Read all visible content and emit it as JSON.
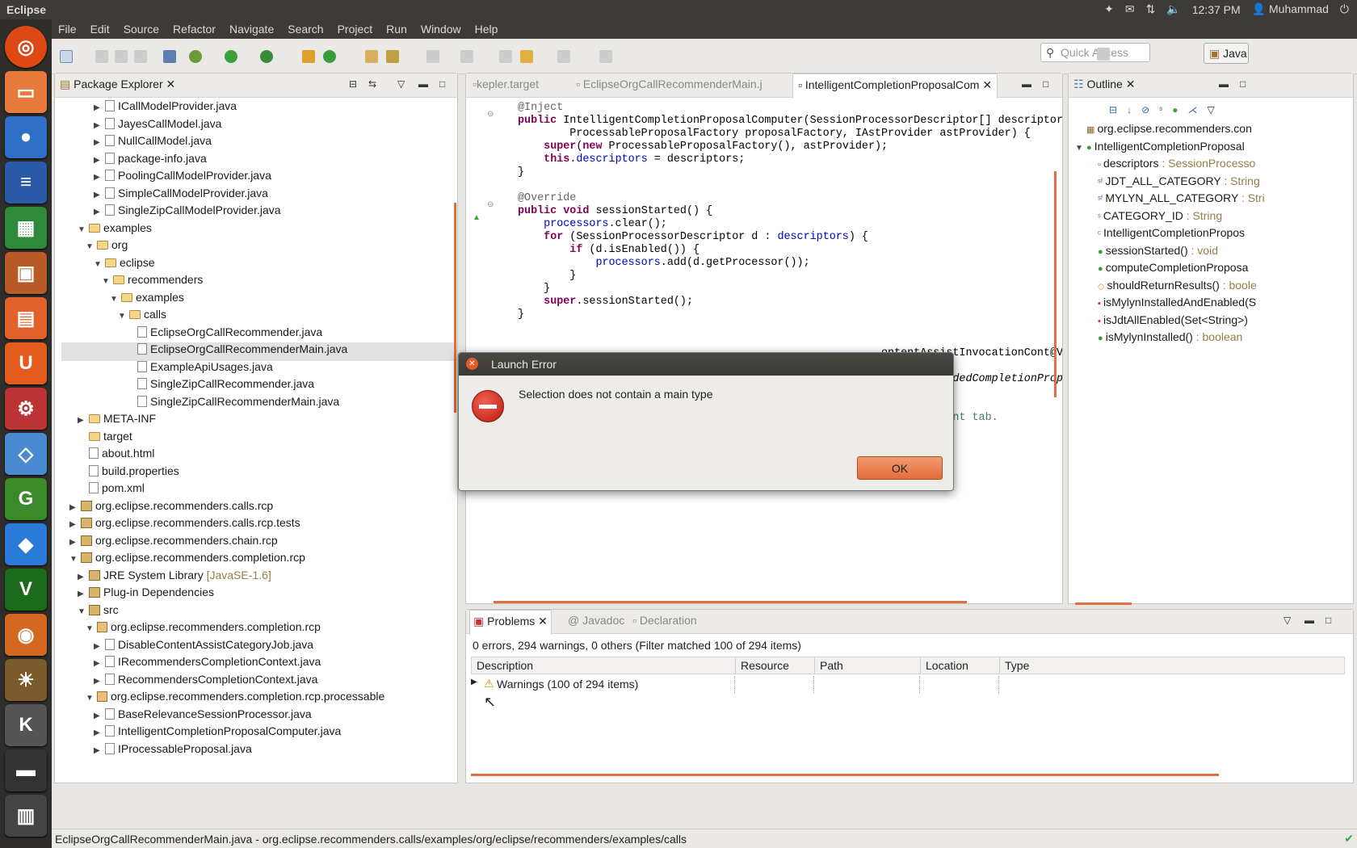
{
  "system": {
    "app_name": "Eclipse",
    "time": "12:37 PM",
    "user": "Muhammad"
  },
  "menu": [
    "File",
    "Edit",
    "Source",
    "Refactor",
    "Navigate",
    "Search",
    "Project",
    "Run",
    "Window",
    "Help"
  ],
  "quick_access": {
    "placeholder": "Quick Access"
  },
  "perspective": {
    "label": "Java"
  },
  "package_explorer": {
    "title": "Package Explorer",
    "rows": [
      {
        "label": "ICallModelProvider.java",
        "kind": "file",
        "twisty": "closed"
      },
      {
        "label": "JayesCallModel.java",
        "kind": "file",
        "twisty": "closed"
      },
      {
        "label": "NullCallModel.java",
        "kind": "file",
        "twisty": "closed"
      },
      {
        "label": "package-info.java",
        "kind": "file",
        "twisty": "closed"
      },
      {
        "label": "PoolingCallModelProvider.java",
        "kind": "file",
        "twisty": "closed"
      },
      {
        "label": "SimpleCallModelProvider.java",
        "kind": "file",
        "twisty": "closed"
      },
      {
        "label": "SingleZipCallModelProvider.java",
        "kind": "file",
        "twisty": "closed"
      },
      {
        "label": "examples",
        "kind": "folder",
        "twisty": "open"
      },
      {
        "label": "org",
        "kind": "folder",
        "twisty": "open"
      },
      {
        "label": "eclipse",
        "kind": "folder",
        "twisty": "open"
      },
      {
        "label": "recommenders",
        "kind": "folder",
        "twisty": "open"
      },
      {
        "label": "examples",
        "kind": "folder",
        "twisty": "open"
      },
      {
        "label": "calls",
        "kind": "folder",
        "twisty": "open"
      },
      {
        "label": "EclipseOrgCallRecommender.java",
        "kind": "file",
        "twisty": ""
      },
      {
        "label": "EclipseOrgCallRecommenderMain.java",
        "kind": "file",
        "twisty": "",
        "selected": true
      },
      {
        "label": "ExampleApiUsages.java",
        "kind": "file",
        "twisty": ""
      },
      {
        "label": "SingleZipCallRecommender.java",
        "kind": "file",
        "twisty": ""
      },
      {
        "label": "SingleZipCallRecommenderMain.java",
        "kind": "file",
        "twisty": ""
      },
      {
        "label": "META-INF",
        "kind": "folder",
        "twisty": "closed"
      },
      {
        "label": "target",
        "kind": "folder",
        "twisty": ""
      },
      {
        "label": "about.html",
        "kind": "file",
        "twisty": ""
      },
      {
        "label": "build.properties",
        "kind": "file",
        "twisty": ""
      },
      {
        "label": "pom.xml",
        "kind": "file",
        "twisty": ""
      },
      {
        "label": "org.eclipse.recommenders.calls.rcp",
        "kind": "project",
        "twisty": "closed"
      },
      {
        "label": "org.eclipse.recommenders.calls.rcp.tests",
        "kind": "project",
        "twisty": "closed"
      },
      {
        "label": "org.eclipse.recommenders.chain.rcp",
        "kind": "project",
        "twisty": "closed"
      },
      {
        "label": "org.eclipse.recommenders.completion.rcp",
        "kind": "project",
        "twisty": "open"
      },
      {
        "label": "JRE System Library",
        "suffix": "[JavaSE-1.6]",
        "kind": "library",
        "twisty": "closed"
      },
      {
        "label": "Plug-in Dependencies",
        "kind": "library",
        "twisty": "closed"
      },
      {
        "label": "src",
        "kind": "project",
        "twisty": "open"
      },
      {
        "label": "org.eclipse.recommenders.completion.rcp",
        "kind": "package",
        "twisty": "open"
      },
      {
        "label": "DisableContentAssistCategoryJob.java",
        "kind": "file",
        "twisty": "closed"
      },
      {
        "label": "IRecommendersCompletionContext.java",
        "kind": "file",
        "twisty": "closed"
      },
      {
        "label": "RecommendersCompletionContext.java",
        "kind": "file",
        "twisty": "closed"
      },
      {
        "label": "org.eclipse.recommenders.completion.rcp.processable",
        "kind": "package",
        "twisty": "open"
      },
      {
        "label": "BaseRelevanceSessionProcessor.java",
        "kind": "file",
        "twisty": "closed"
      },
      {
        "label": "IntelligentCompletionProposalComputer.java",
        "kind": "file",
        "twisty": "closed"
      },
      {
        "label": "IProcessableProposal.java",
        "kind": "file",
        "twisty": "closed"
      }
    ]
  },
  "editor": {
    "tabs": [
      "kepler.target",
      "EclipseOrgCallRecommenderMain.j",
      "IntelligentCompletionProposalCom"
    ],
    "partial_line": "ontentAssistInvocationCont"
  },
  "outline": {
    "title": "Outline",
    "items": [
      {
        "label": "org.eclipse.recommenders.con",
        "type": ""
      },
      {
        "label": "IntelligentCompletionProposal",
        "type": ""
      },
      {
        "label": "descriptors",
        "type": " : SessionProcesso"
      },
      {
        "label": "JDT_ALL_CATEGORY",
        "type": " : String"
      },
      {
        "label": "MYLYN_ALL_CATEGORY",
        "type": " : Stri"
      },
      {
        "label": "CATEGORY_ID",
        "type": " : String"
      },
      {
        "label": "IntelligentCompletionPropos",
        "type": ""
      },
      {
        "label": "sessionStarted()",
        "type": " : void"
      },
      {
        "label": "computeCompletionProposa",
        "type": ""
      },
      {
        "label": "shouldReturnResults()",
        "type": " : boole"
      },
      {
        "label": "isMylynInstalledAndEnabled(S",
        "type": ""
      },
      {
        "label": "isJdtAllEnabled(Set<String>)",
        "type": ""
      },
      {
        "label": "isMylynInstalled()",
        "type": " : boolean"
      }
    ]
  },
  "problems": {
    "tabs": [
      "Problems",
      "Javadoc",
      "Declaration"
    ],
    "summary": "0 errors, 294 warnings, 0 others (Filter matched 100 of 294 items)",
    "columns": [
      "Description",
      "Resource",
      "Path",
      "Location",
      "Type"
    ],
    "rows": [
      "Warnings (100 of 294 items)"
    ]
  },
  "status": {
    "text": "EclipseOrgCallRecommenderMain.java - org.eclipse.recommenders.calls/examples/org/eclipse/recommenders/examples/calls"
  },
  "dialog": {
    "title": "Launch Error",
    "message": "Selection does not contain a main type",
    "ok": "OK"
  }
}
